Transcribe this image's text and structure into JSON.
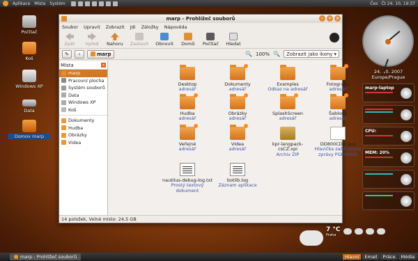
{
  "top_panel": {
    "menus": [
      "Aplikace",
      "Místa",
      "Systém"
    ],
    "right_text": "Čes",
    "clock": "Čt 24. 10, 19:37"
  },
  "desktop_icons": [
    {
      "label": "Počítač"
    },
    {
      "label": "Koš"
    },
    {
      "label": "Windows XP"
    },
    {
      "label": "Data"
    },
    {
      "label": "Domov marp"
    }
  ],
  "window": {
    "title": "marp - Prohlížeč souborů",
    "menus": [
      "Soubor",
      "Upravit",
      "Zobrazit",
      "Jdi",
      "Záložky",
      "Nápověda"
    ],
    "toolbar": {
      "back": "Zpět",
      "forward": "Vpřed",
      "up": "Nahoru",
      "stop": "Zastavit",
      "reload": "Obnovit",
      "home": "Domů",
      "computer": "Počítač",
      "search": "Hledat"
    },
    "location": {
      "crumb": "marp",
      "zoom": "100%",
      "view": "Zobrazit jako ikony"
    },
    "sidebar": {
      "header": "Místa",
      "places": [
        "marp",
        "Pracovní plocha",
        "Systém souborů",
        "Data",
        "Windows XP",
        "Koš"
      ],
      "bookmarks": [
        "Dokumenty",
        "Hudba",
        "Obrázky",
        "Videa"
      ]
    },
    "files": [
      {
        "name": "Desktop",
        "type": "adresář"
      },
      {
        "name": "Dokumenty",
        "type": "adresář"
      },
      {
        "name": "Examples",
        "type": "Odkaz na adresář"
      },
      {
        "name": "Fotografie",
        "type": "adresář"
      },
      {
        "name": "Hudba",
        "type": "adresář"
      },
      {
        "name": "Obrázky",
        "type": "adresář"
      },
      {
        "name": "SplashScreen",
        "type": "adresář"
      },
      {
        "name": "Šablony",
        "type": "adresář"
      },
      {
        "name": "Veřejné",
        "type": "adresář"
      },
      {
        "name": "Videa",
        "type": "adresář"
      },
      {
        "name": "kpr-langpack-csCZ.xpi",
        "type": "Archiv ZIP"
      },
      {
        "name": "DD800CD8.gpg",
        "type": "Hlavička zašifrované zprávy PGP/MIME"
      },
      {
        "name": "nautilus-debug-log.txt",
        "type": "Prostý textový dokument"
      },
      {
        "name": "botlib.log",
        "type": "Záznam aplikace"
      }
    ],
    "status": "14 položek, Volné místo: 24,5 GB"
  },
  "widgets": {
    "date": "24. 10. 2007",
    "tz": "Europe/Prague",
    "host": "marp-laptop",
    "cpu": "CPU:",
    "mem": "MEM: 20%"
  },
  "weather": {
    "temp": "7 °C",
    "detail": "Praha"
  },
  "bottom_panel": {
    "task": "marp - Prohlížeč souborů",
    "workspaces": [
      "Hlavní",
      "Email",
      "Práce",
      "Média"
    ]
  }
}
